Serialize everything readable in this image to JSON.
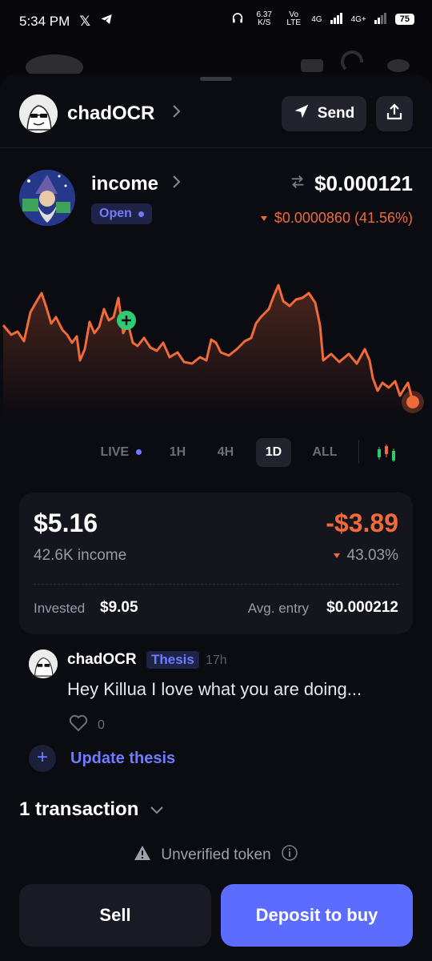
{
  "status_bar": {
    "time": "5:34 PM",
    "speed": "6.37 K/S",
    "net1": "Vo LTE",
    "net2": "4G",
    "net3": "4G+",
    "battery": "75"
  },
  "header": {
    "name": "chadOCR",
    "send_label": "Send",
    "icons": [
      "chevron-right-icon",
      "send-icon",
      "share-icon"
    ]
  },
  "token": {
    "name": "income",
    "status": "Open",
    "price": "$0.000121",
    "change": "$0.0000860 (41.56%)",
    "change_direction": "down",
    "accent_color": "#f06a3a"
  },
  "timeframes": {
    "items": [
      "LIVE",
      "1H",
      "4H",
      "1D",
      "ALL"
    ],
    "selected": "1D"
  },
  "position": {
    "value": "$5.16",
    "pnl": "-$3.89",
    "amount": "42.6K income",
    "pnl_pct": "43.03%",
    "invested_label": "Invested",
    "invested_value": "$9.05",
    "avg_label": "Avg. entry",
    "avg_value": "$0.000212"
  },
  "thesis": {
    "user": "chadOCR",
    "tag": "Thesis",
    "time": "17h",
    "text": "Hey Killua I love what you are doing...",
    "likes": "0",
    "update_label": "Update thesis"
  },
  "transactions": {
    "label": "1 transaction"
  },
  "warning": {
    "label": "Unverified token"
  },
  "actions": {
    "sell": "Sell",
    "buy": "Deposit to buy"
  },
  "colors": {
    "primary": "#5b6cff",
    "negative": "#f06a3a",
    "positive": "#2ecc71"
  }
}
